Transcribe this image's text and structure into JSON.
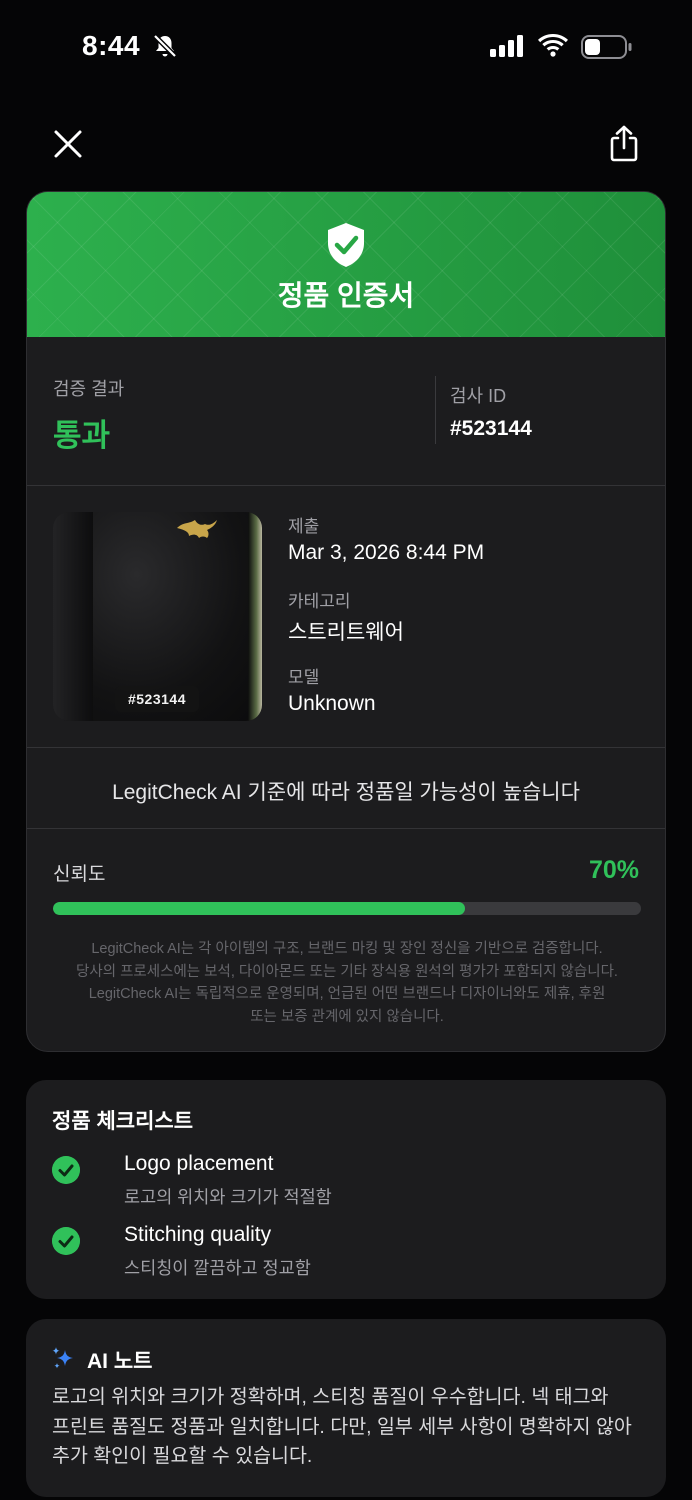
{
  "status_bar": {
    "time": "8:44"
  },
  "certificate": {
    "title": "정품 인증서",
    "result_label": "검증 결과",
    "result_value": "통과",
    "id_label": "검사 ID",
    "id_value": "#523144",
    "photo_tag": "#523144",
    "submitted_label": "제출",
    "submitted_value": "Mar 3, 2026 8:44 PM",
    "category_label": "카테고리",
    "category_value": "스트리트웨어",
    "model_label": "모델",
    "model_value": "Unknown",
    "verdict": "LegitCheck AI 기준에 따라 정품일 가능성이 높습니다",
    "confidence_label": "신뢰도",
    "confidence_value": "70%",
    "confidence_fraction": 0.7,
    "disclaimer_lines": [
      "LegitCheck AI는 각 아이템의 구조, 브랜드 마킹 및 장인 정신을 기반으로 검증합니다.",
      "당사의 프로세스에는 보석, 다이아몬드 또는 기타 장식용 원석의 평가가 포함되지 않습니다.",
      "LegitCheck AI는 독립적으로 운영되며, 언급된 어떤 브랜드나 디자이너와도 제휴, 후원",
      "또는 보증 관계에 있지 않습니다."
    ]
  },
  "checklist": {
    "title": "정품 체크리스트",
    "items": [
      {
        "title": "Logo placement",
        "desc": "로고의 위치와 크기가 적절함"
      },
      {
        "title": "Stitching quality",
        "desc": "스티칭이 깔끔하고 정교함"
      }
    ]
  },
  "ai_note": {
    "title": "AI 노트",
    "lines": [
      "로고의 위치와 크기가 정확하며, 스티칭 품질이 우수합니다. 넥 태그와",
      "프린트 품질도 정품과 일치합니다. 다만, 일부 세부 사항이 명확하지 않아",
      "추가 확인이 필요할 수 있습니다."
    ]
  },
  "colors": {
    "accent_green": "#30c15a",
    "header_green": "#28a745",
    "card": "#1c1c1e",
    "ai_sparkle": "#3b82f6"
  },
  "icons": [
    "bell-slash-icon",
    "cellular-signal-icon",
    "wifi-icon",
    "battery-icon",
    "close-icon",
    "share-icon",
    "shield-check-icon",
    "check-circle-icon",
    "sparkle-icon"
  ]
}
